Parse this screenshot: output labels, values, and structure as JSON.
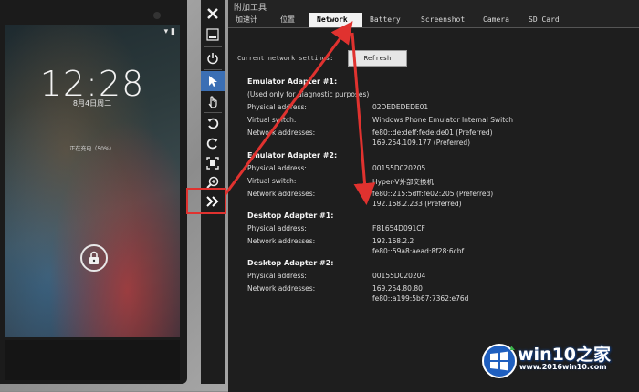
{
  "phone": {
    "status_icons": "▾ ▮",
    "clock": "12:28",
    "date": "8月4日周二",
    "charging": "正在充电（50%）",
    "lock_icon": "lock-icon"
  },
  "toolbar": {
    "close_icon": "close-icon",
    "minimize_icon": "minimize-icon",
    "power_icon": "power-icon",
    "pointer_icon": "pointer-icon",
    "touch_icon": "touch-icon",
    "rotate_left_icon": "rotate-left-icon",
    "rotate_right_icon": "rotate-right-icon",
    "fit_icon": "fit-screen-icon",
    "zoom_icon": "zoom-icon",
    "more_icon": "chevron-double-right-icon"
  },
  "tools": {
    "title": "附加工具",
    "tabs": [
      "加速计",
      "位置",
      "Network",
      "Battery",
      "Screenshot",
      "Camera",
      "SD Card"
    ],
    "active_tab": "Network",
    "current_settings_label": "Current network settings:",
    "refresh_label": "Refresh",
    "adapters": [
      {
        "title": "Emulator Adapter #1:",
        "note": "(Used only for diagnostic purposes)",
        "rows": [
          {
            "label": "Physical address:",
            "value": "02DEDEDEDE01"
          },
          {
            "label": "Virtual switch:",
            "value": "Windows Phone Emulator Internal Switch"
          },
          {
            "label": "Network addresses:",
            "value": "fe80::de:deff:fede:de01 (Preferred)"
          },
          {
            "label": "",
            "value": "169.254.109.177 (Preferred)"
          }
        ]
      },
      {
        "title": "Emulator Adapter #2:",
        "rows": [
          {
            "label": "Physical address:",
            "value": "00155D020205"
          },
          {
            "label": "Virtual switch:",
            "value": "Hyper-V外部交换机"
          },
          {
            "label": "Network addresses:",
            "value": "fe80::215:5dff:fe02:205 (Preferred)"
          },
          {
            "label": "",
            "value": "192.168.2.233 (Preferred)"
          }
        ]
      },
      {
        "title": "Desktop Adapter #1:",
        "rows": [
          {
            "label": "Physical address:",
            "value": "F81654D091CF"
          },
          {
            "label": "Network addresses:",
            "value": "192.168.2.2"
          },
          {
            "label": "",
            "value": "fe80::59a8:aead:8f28:6cbf"
          }
        ]
      },
      {
        "title": "Desktop Adapter #2:",
        "rows": [
          {
            "label": "Physical address:",
            "value": "00155D020204"
          },
          {
            "label": "Network addresses:",
            "value": "169.254.80.80"
          },
          {
            "label": "",
            "value": "fe80::a199:5b67:7362:e76d"
          }
        ]
      }
    ]
  },
  "watermark": {
    "brand": "win10之家",
    "url": "www.2016win10.com"
  },
  "colors": {
    "annotation_red": "#e0322f",
    "active_tab_bg": "#f2f2f2",
    "toolbar_active": "#3b6fb4"
  }
}
